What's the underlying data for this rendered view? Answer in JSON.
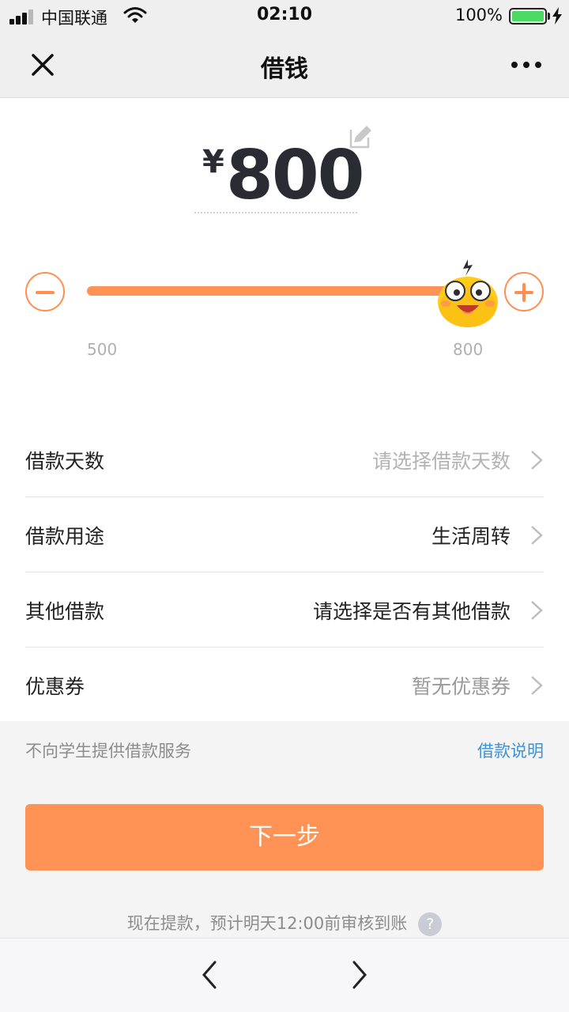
{
  "status_bar": {
    "carrier": "中国联通",
    "time": "02:10",
    "battery": "100%"
  },
  "nav": {
    "title": "借钱",
    "close_icon": "close-icon",
    "more_icon": "more-icon"
  },
  "amount": {
    "currency": "¥",
    "value": "800",
    "edit_icon": "edit-icon"
  },
  "slider": {
    "min_label": "500",
    "max_label": "800",
    "fill_fraction": 0.96
  },
  "form": {
    "rows": [
      {
        "label": "借款天数",
        "value": "请选择借款天数"
      },
      {
        "label": "借款用途",
        "value": "生活周转"
      },
      {
        "label": "其他借款",
        "value": "请选择是否有其他借款"
      },
      {
        "label": "优惠券",
        "value": "暂无优惠券"
      }
    ]
  },
  "notice": {
    "text": "不向学生提供借款服务",
    "link": "借款说明"
  },
  "next_button": "下一步",
  "footer": {
    "note": "现在提款，预计明天12:00前审核到账",
    "help": "?"
  },
  "colors": {
    "accent": "#ff9356",
    "link": "#3d92d8",
    "battery": "#4cd964"
  }
}
